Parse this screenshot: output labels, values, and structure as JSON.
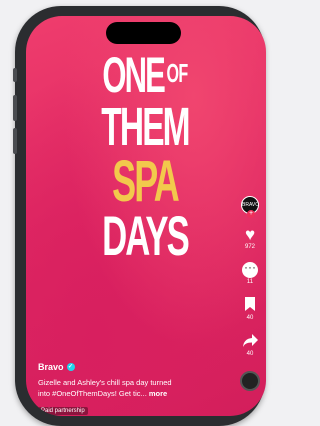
{
  "promo": {
    "line1": "ONE",
    "line1_small": "OF",
    "line2": "THEM",
    "line3": "SPA",
    "line4": "DAYS"
  },
  "rail": {
    "avatar_label": "BRAVO",
    "likes": "972",
    "comments": "11",
    "saves": "40",
    "shares": "40"
  },
  "caption": {
    "username": "Bravo",
    "text_line1": "Gizelle and Ashley's chill spa day turned",
    "text_line2": "into #OneOfThemDays! Get tic...",
    "more": "more",
    "paid_tag": "Paid partnership"
  },
  "colors": {
    "background": "#e02863",
    "accent_yellow": "#f2c94c"
  },
  "icons": [
    "heart-icon",
    "comment-icon",
    "bookmark-icon",
    "share-icon",
    "verified-icon"
  ]
}
